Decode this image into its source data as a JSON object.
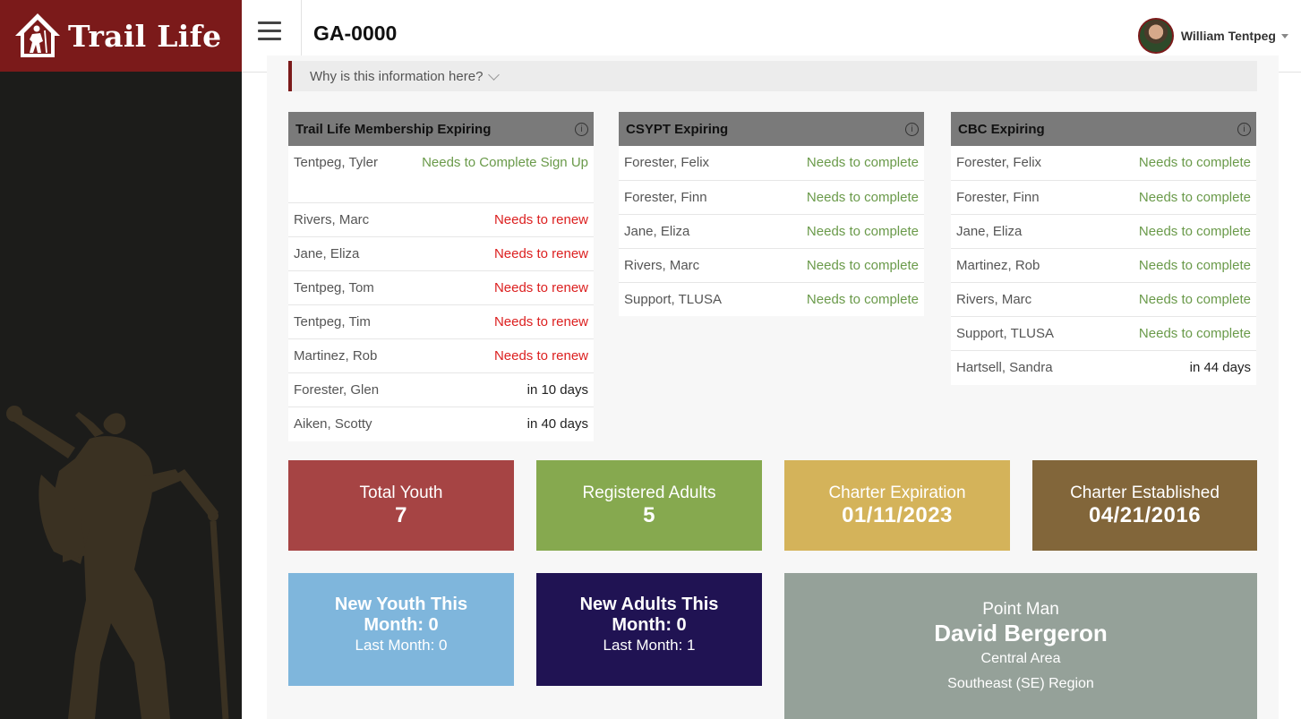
{
  "brand": {
    "name": "Trail Life"
  },
  "header": {
    "unit": "GA-0000",
    "user_name": "William Tentpeg"
  },
  "why_link": "Why is this information here?",
  "panels": [
    {
      "title": "Trail Life Membership Expiring",
      "rows": [
        {
          "name": "Tentpeg, Tyler",
          "status": "Needs to Complete Sign Up"
        },
        {
          "name": "Rivers, Marc",
          "status": "Needs to renew"
        },
        {
          "name": "Jane, Eliza",
          "status": "Needs to renew"
        },
        {
          "name": "Tentpeg, Tom",
          "status": "Needs to renew"
        },
        {
          "name": "Tentpeg, Tim",
          "status": "Needs to renew"
        },
        {
          "name": "Martinez, Rob",
          "status": "Needs to renew"
        },
        {
          "name": "Forester, Glen",
          "status": "in 10 days"
        },
        {
          "name": "Aiken, Scotty",
          "status": "in 40 days"
        }
      ]
    },
    {
      "title": "CSYPT Expiring",
      "rows": [
        {
          "name": "Forester, Felix",
          "status": "Needs to complete"
        },
        {
          "name": "Forester, Finn",
          "status": "Needs to complete"
        },
        {
          "name": "Jane, Eliza",
          "status": "Needs to complete"
        },
        {
          "name": "Rivers, Marc",
          "status": "Needs to complete"
        },
        {
          "name": "Support, TLUSA",
          "status": "Needs to complete"
        }
      ]
    },
    {
      "title": "CBC Expiring",
      "rows": [
        {
          "name": "Forester, Felix",
          "status": "Needs to complete"
        },
        {
          "name": "Forester, Finn",
          "status": "Needs to complete"
        },
        {
          "name": "Jane, Eliza",
          "status": "Needs to complete"
        },
        {
          "name": "Martinez, Rob",
          "status": "Needs to complete"
        },
        {
          "name": "Rivers, Marc",
          "status": "Needs to complete"
        },
        {
          "name": "Support, TLUSA",
          "status": "Needs to complete"
        },
        {
          "name": "Hartsell, Sandra",
          "status": "in 44 days"
        }
      ]
    }
  ],
  "stats": {
    "total_youth": {
      "label": "Total Youth",
      "value": "7"
    },
    "registered_adults": {
      "label": "Registered Adults",
      "value": "5"
    },
    "charter_expiration": {
      "label": "Charter Expiration",
      "value": "01/11/2023"
    },
    "charter_established": {
      "label": "Charter Established",
      "value": "04/21/2016"
    },
    "new_youth": {
      "line1": "New Youth This",
      "line2": "Month: 0",
      "last": "Last Month: 0"
    },
    "new_adults": {
      "line1": "New Adults This",
      "line2": "Month: 0",
      "last": "Last Month: 1"
    },
    "point_man": {
      "label": "Point Man",
      "name": "David Bergeron",
      "area": "Central Area",
      "region": "Southeast (SE) Region"
    }
  },
  "colors": {
    "brand_red": "#7b1a1a",
    "total_youth": "#a64444",
    "registered_adults": "#86a94f",
    "charter_expiration": "#d4b35a",
    "charter_established": "#82663a",
    "new_youth": "#7fb6dc",
    "new_adults": "#201353",
    "point_man": "#95a199",
    "complete_text": "#6a9a4a",
    "renew_text": "#dc2020"
  }
}
